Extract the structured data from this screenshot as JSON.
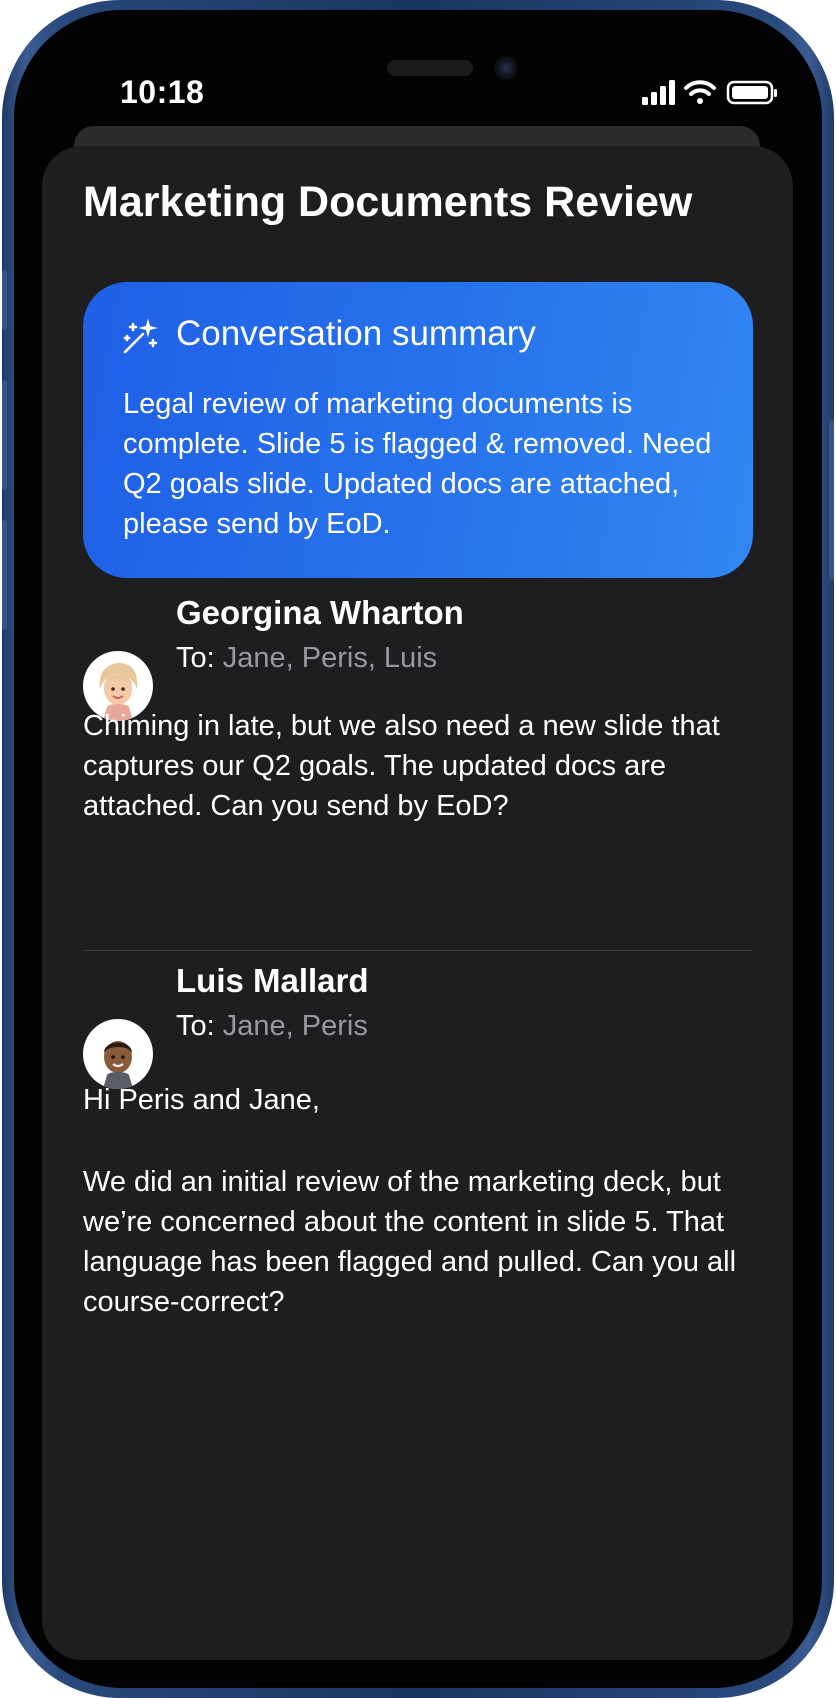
{
  "status_bar": {
    "time": "10:18",
    "icons": [
      "cellular-signal-icon",
      "wifi-icon",
      "battery-icon"
    ]
  },
  "thread": {
    "title": "Marketing Documents Review"
  },
  "summary": {
    "icon": "sparkles-icon",
    "title": "Conversation summary",
    "text": "Legal review of marketing documents is complete. Slide 5 is flagged & removed. Need Q2 goals slide. Updated docs are attached, please send by EoD."
  },
  "messages": [
    {
      "sender": "Georgina Wharton",
      "to_label": "To:",
      "recipients": "Jane,  Peris,  Luis",
      "body": [
        "Chiming in late, but we also need a new slide that captures our Q2 goals. The updated docs are attached. Can you send by EoD?"
      ]
    },
    {
      "sender": "Luis Mallard",
      "to_label": "To:",
      "recipients": "Jane,  Peris",
      "body": [
        "Hi Peris and Jane,",
        "We did an initial review of the marketing deck, but we’re concerned about the content in slide 5. That language has been flagged and pulled. Can you all course-correct?"
      ]
    }
  ],
  "colors": {
    "summary_gradient_start": "#1f5fe6",
    "summary_gradient_end": "#3287f2",
    "sheet_background": "#1e1e20",
    "recipient_text": "#98989e",
    "device_frame": "#1a3460"
  }
}
